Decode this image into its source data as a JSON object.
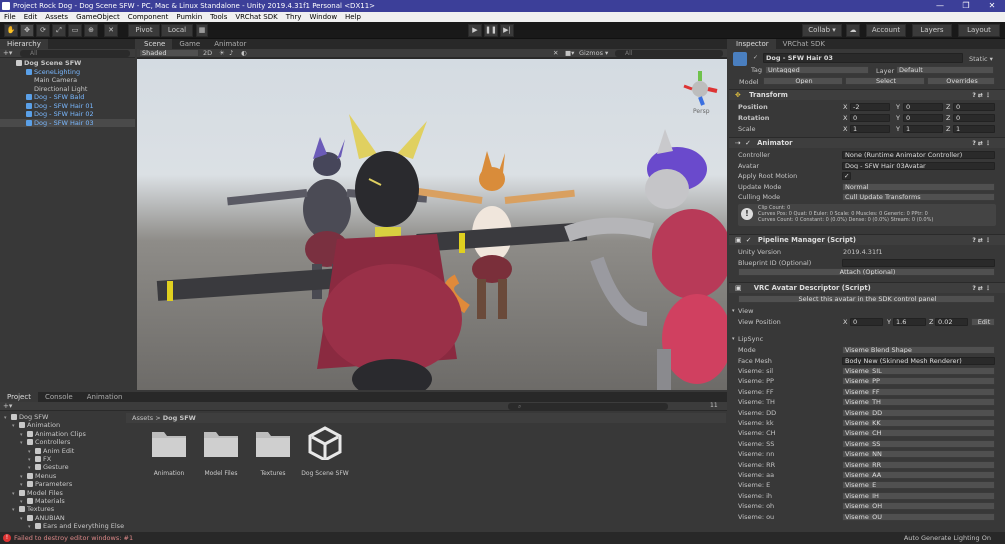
{
  "title": "Project Rock Dog - Dog Scene SFW - PC, Mac & Linux Standalone - Unity 2019.4.31f1 Personal <DX11>",
  "window_buttons": [
    "—",
    "❐",
    "✕"
  ],
  "menu": [
    "File",
    "Edit",
    "Assets",
    "GameObject",
    "Component",
    "Pumkin",
    "Tools",
    "VRChat SDK",
    "Thry",
    "Window",
    "Help"
  ],
  "toolbar": {
    "pivot": "Pivot",
    "local": "Local",
    "collab": "Collab ▾",
    "account": "Account",
    "layers": "Layers",
    "layout": "Layout"
  },
  "hierarchy": {
    "tab": "Hierarchy",
    "search": "All",
    "items": [
      {
        "label": "Dog Scene SFW",
        "indent": 0,
        "type": "scene"
      },
      {
        "label": "SceneLighting",
        "indent": 1,
        "type": "prefab",
        "blue": true
      },
      {
        "label": "Main Camera",
        "indent": 1,
        "type": "obj"
      },
      {
        "label": "Directional Light",
        "indent": 1,
        "type": "obj"
      },
      {
        "label": "Dog - SFW Bald",
        "indent": 1,
        "type": "prefab",
        "blue": true
      },
      {
        "label": "Dog - SFW Hair 01",
        "indent": 1,
        "type": "prefab",
        "blue": true
      },
      {
        "label": "Dog - SFW Hair 02",
        "indent": 1,
        "type": "prefab",
        "blue": true
      },
      {
        "label": "Dog - SFW Hair 03",
        "indent": 1,
        "type": "prefab",
        "blue": true,
        "selected": true
      }
    ]
  },
  "scene": {
    "tabs": [
      "Scene",
      "Game",
      "Animator"
    ],
    "shading": "Shaded",
    "mode2d": "2D",
    "gizmos": "Gizmos ▾",
    "search": "All",
    "persp": "Persp"
  },
  "inspector": {
    "tabs": [
      "Inspector",
      "VRChat SDK"
    ],
    "object_name": "Dog - SFW Hair 03",
    "static": "Static ▾",
    "tag_label": "Tag",
    "tag": "Untagged",
    "layer_label": "Layer",
    "layer": "Default",
    "model_label": "Model",
    "model_buttons": [
      "Open",
      "Select",
      "Overrides"
    ],
    "transform": {
      "header": "Transform",
      "rows": [
        {
          "label": "Position",
          "x": "-2",
          "y": "0",
          "z": "0"
        },
        {
          "label": "Rotation",
          "x": "0",
          "y": "0",
          "z": "0"
        },
        {
          "label": "Scale",
          "x": "1",
          "y": "1",
          "z": "1"
        }
      ]
    },
    "animator": {
      "header": "Animator",
      "rows": [
        {
          "label": "Controller",
          "value": "None (Runtime Animator Controller)"
        },
        {
          "label": "Avatar",
          "value": "Dog - SFW Hair 03Avatar"
        },
        {
          "label": "Apply Root Motion",
          "value": "✓"
        },
        {
          "label": "Update Mode",
          "value": "Normal"
        },
        {
          "label": "Culling Mode",
          "value": "Cull Update Transforms"
        }
      ],
      "info": [
        "Clip Count: 0",
        "Curves Pos: 0 Quat: 0 Euler: 0 Scale: 0 Muscles: 0 Generic: 0 PPtr: 0",
        "Curves Count: 0 Constant: 0 (0.0%) Dense: 0 (0.0%) Stream: 0 (0.0%)"
      ]
    },
    "pipeline": {
      "header": "Pipeline Manager (Script)",
      "rows": [
        {
          "label": "Unity Version",
          "value": "2019.4.31f1"
        },
        {
          "label": "Blueprint ID (Optional)",
          "value": ""
        }
      ],
      "attach": "Attach (Optional)"
    },
    "descriptor": {
      "header": "VRC Avatar Descriptor (Script)",
      "select_button": "Select this avatar in the SDK control panel",
      "view_section": "View",
      "view_label": "View Position",
      "view_x": "0",
      "view_y": "1.6",
      "view_z": "0.02",
      "edit": "Edit",
      "lipsync_section": "LipSync",
      "mode_label": "Mode",
      "mode": "Viseme Blend Shape",
      "face_mesh_label": "Face Mesh",
      "face_mesh": "Body New (Skinned Mesh Renderer)",
      "visemes": [
        {
          "label": "Viseme: sil",
          "value": "Viseme_SIL"
        },
        {
          "label": "Viseme: PP",
          "value": "Viseme_PP"
        },
        {
          "label": "Viseme: FF",
          "value": "Viseme_FF"
        },
        {
          "label": "Viseme: TH",
          "value": "Viseme_TH"
        },
        {
          "label": "Viseme: DD",
          "value": "Viseme_DD"
        },
        {
          "label": "Viseme: kk",
          "value": "Viseme_KK"
        },
        {
          "label": "Viseme: CH",
          "value": "Viseme_CH"
        },
        {
          "label": "Viseme: SS",
          "value": "Viseme_SS"
        },
        {
          "label": "Viseme: nn",
          "value": "Viseme_NN"
        },
        {
          "label": "Viseme: RR",
          "value": "Viseme_RR"
        },
        {
          "label": "Viseme: aa",
          "value": "Viseme_AA"
        },
        {
          "label": "Viseme: E",
          "value": "Viseme_E"
        },
        {
          "label": "Viseme: ih",
          "value": "Viseme_IH"
        },
        {
          "label": "Viseme: oh",
          "value": "Viseme_OH"
        },
        {
          "label": "Viseme: ou",
          "value": "Viseme_OU"
        }
      ]
    }
  },
  "project": {
    "tabs": [
      "Project",
      "Console",
      "Animation"
    ],
    "tree": [
      {
        "label": "Dog SFW",
        "indent": 0
      },
      {
        "label": "Animation",
        "indent": 1
      },
      {
        "label": "Animation Clips",
        "indent": 2
      },
      {
        "label": "Controllers",
        "indent": 2
      },
      {
        "label": "Anim Edit",
        "indent": 3
      },
      {
        "label": "FX",
        "indent": 3
      },
      {
        "label": "Gesture",
        "indent": 3
      },
      {
        "label": "Menus",
        "indent": 2
      },
      {
        "label": "Parameters",
        "indent": 2
      },
      {
        "label": "Model Files",
        "indent": 1
      },
      {
        "label": "Materials",
        "indent": 2
      },
      {
        "label": "Textures",
        "indent": 1
      },
      {
        "label": "ANUBIAN",
        "indent": 2
      },
      {
        "label": "Ears and Everything Else",
        "indent": 3
      }
    ],
    "breadcrumb": [
      "Assets",
      "Dog SFW"
    ],
    "count": "11",
    "assets": [
      {
        "label": "Animation",
        "kind": "folder"
      },
      {
        "label": "Model Files",
        "kind": "folder"
      },
      {
        "label": "Textures",
        "kind": "folder"
      },
      {
        "label": "Dog Scene SFW",
        "kind": "unity"
      }
    ]
  },
  "status": {
    "error": "Failed to destroy editor windows: #1",
    "right": "Auto Generate Lighting On"
  }
}
